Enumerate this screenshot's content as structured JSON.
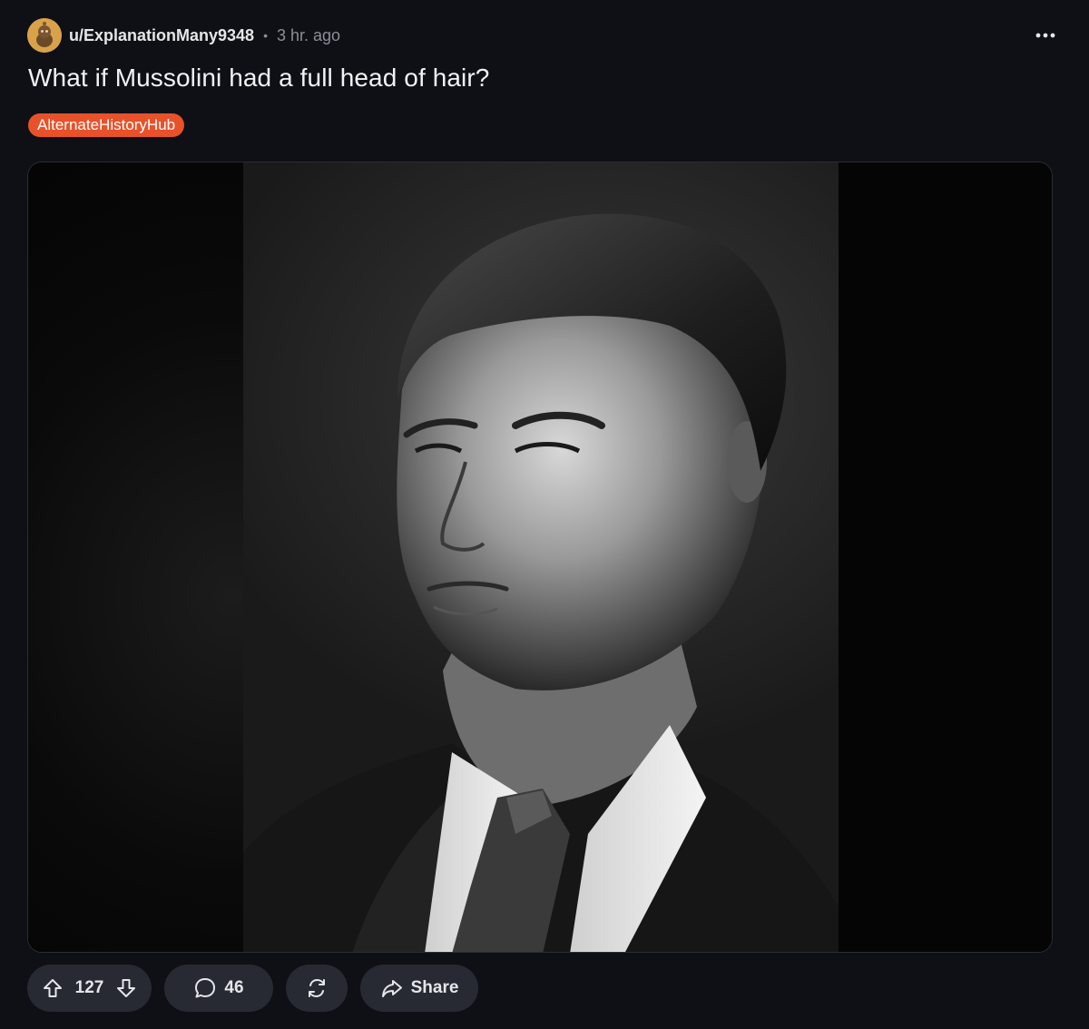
{
  "post": {
    "username": "u/ExplanationMany9348",
    "separator": "•",
    "time": "3 hr. ago",
    "title": "What if Mussolini had a full head of hair?",
    "flair": "AlternateHistoryHub",
    "image_icon": "portrait-photo"
  },
  "actions": {
    "vote_count": "127",
    "comment_count": "46",
    "share_label": "Share"
  },
  "colors": {
    "background": "#0e1016",
    "flair": "#e8522a",
    "pill": "#272a33"
  }
}
